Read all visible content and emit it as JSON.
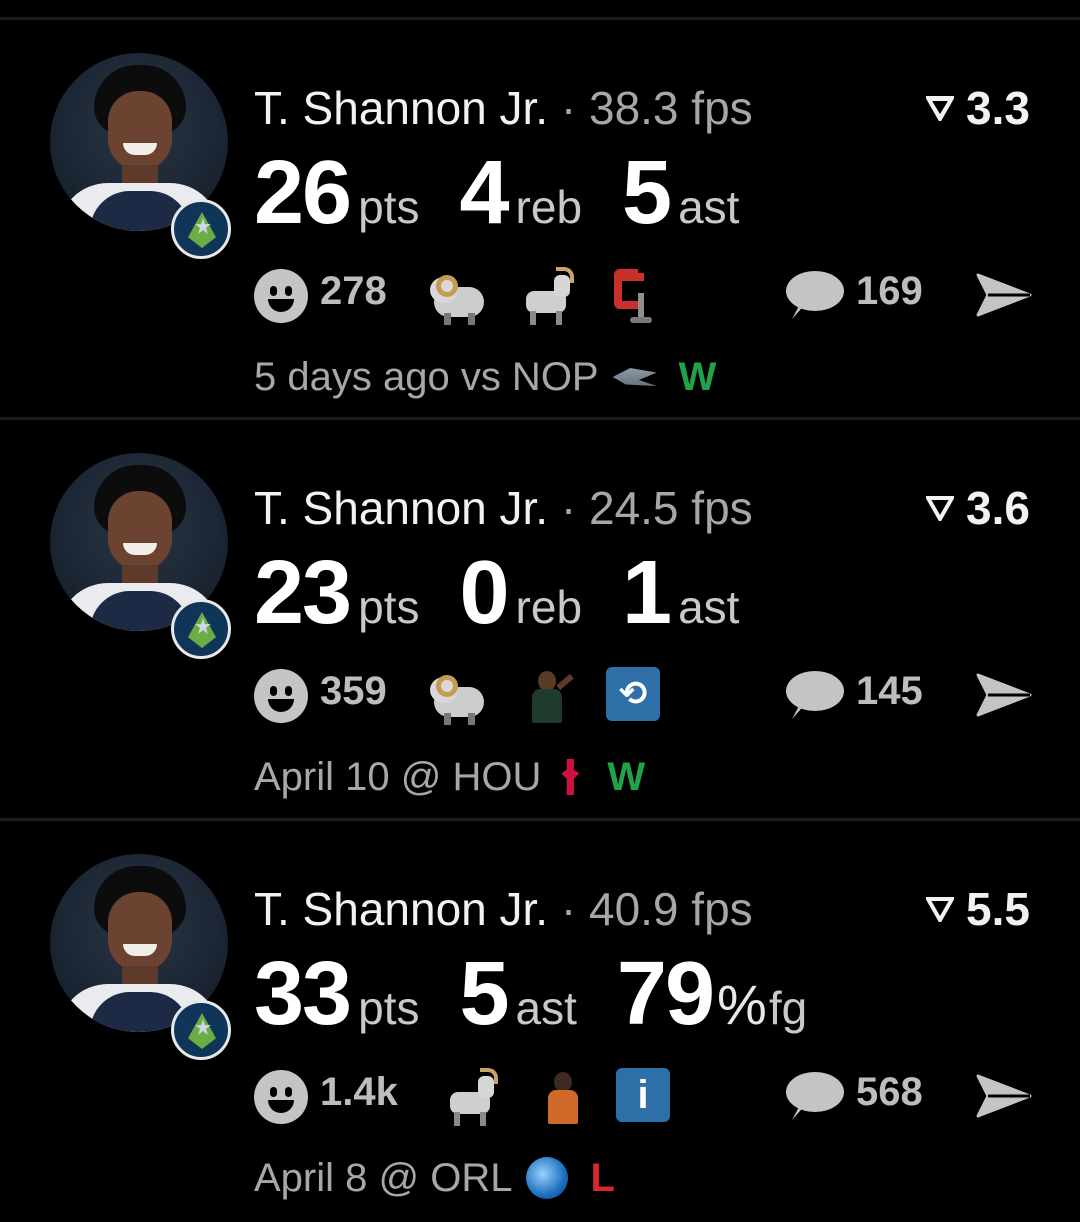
{
  "cards": [
    {
      "name": "T. Shannon Jr.",
      "sep": "·",
      "fps": "38.3 fps",
      "rating": "3.3",
      "stats": [
        {
          "num": "26",
          "pct": "",
          "unit": "pts"
        },
        {
          "num": "4",
          "pct": "",
          "unit": "reb"
        },
        {
          "num": "5",
          "pct": "",
          "unit": "ast"
        }
      ],
      "reactions": "278",
      "emojis": [
        "ram-icon",
        "goat-icon",
        "clamp-icon"
      ],
      "comments": "169",
      "game": "5 days ago vs NOP",
      "team_logo": "pelicans-logo-icon",
      "result": "W",
      "result_color": "#1fa34a"
    },
    {
      "name": "T. Shannon Jr.",
      "sep": "·",
      "fps": "24.5 fps",
      "rating": "3.6",
      "stats": [
        {
          "num": "23",
          "pct": "",
          "unit": "pts"
        },
        {
          "num": "0",
          "pct": "",
          "unit": "reb"
        },
        {
          "num": "1",
          "pct": "",
          "unit": "ast"
        }
      ],
      "reactions": "359",
      "emojis": [
        "ram-icon",
        "player-gesture-icon",
        "repost-icon"
      ],
      "comments": "145",
      "game": "April 10 @ HOU",
      "team_logo": "rockets-logo-icon",
      "result": "W",
      "result_color": "#1fa34a"
    },
    {
      "name": "T. Shannon Jr.",
      "sep": "·",
      "fps": "40.9 fps",
      "rating": "5.5",
      "stats": [
        {
          "num": "33",
          "pct": "",
          "unit": "pts"
        },
        {
          "num": "5",
          "pct": "",
          "unit": "ast"
        },
        {
          "num": "79",
          "pct": "%",
          "unit": "fg"
        }
      ],
      "reactions": "1.4k",
      "emojis": [
        "goat-icon",
        "player-orange-icon",
        "info-icon"
      ],
      "comments": "568",
      "game": "April 8 @ ORL",
      "team_logo": "magic-logo-icon",
      "result": "L",
      "result_color": "#d62828"
    }
  ],
  "colors": {
    "background": "#000000",
    "divider": "#1c1c1c",
    "secondary_text": "#a7a7a7",
    "win": "#1fa34a",
    "loss": "#d62828"
  }
}
